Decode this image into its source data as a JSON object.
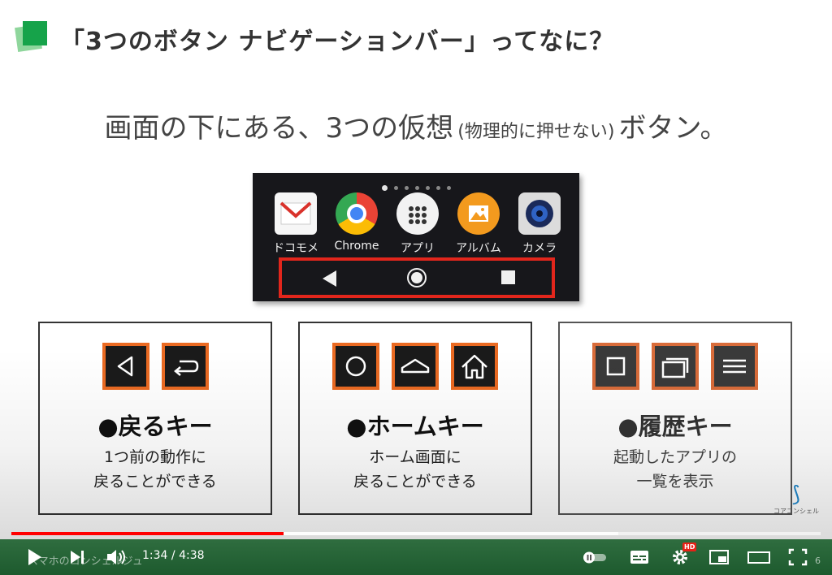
{
  "slide": {
    "title": "「3つのボタン ナビゲーションバー」ってなに？",
    "subtitle_main": "画面の下にある、3つの仮想",
    "subtitle_paren": "(物理的に押せない)",
    "subtitle_end": "ボタン。",
    "page_number": "6"
  },
  "phone": {
    "apps": [
      {
        "label": "ドコモメ",
        "icon": "mail-icon"
      },
      {
        "label": "Chrome",
        "icon": "chrome-icon"
      },
      {
        "label": "アプリ",
        "icon": "app-drawer-icon"
      },
      {
        "label": "アルバム",
        "icon": "album-icon"
      },
      {
        "label": "カメラ",
        "icon": "camera-icon"
      }
    ],
    "nav_buttons": [
      "back-triangle-icon",
      "home-circle-icon",
      "recent-square-icon"
    ]
  },
  "cards": [
    {
      "title": "●戻るキー",
      "desc_line1": "1つ前の動作に",
      "desc_line2": "戻ることができる",
      "icons": [
        "back-triangle-icon",
        "back-arrow-icon"
      ]
    },
    {
      "title": "●ホームキー",
      "desc_line1": "ホーム画面に",
      "desc_line2": "戻ることができる",
      "icons": [
        "home-circle-icon",
        "home-roof-icon",
        "home-house-icon"
      ]
    },
    {
      "title": "●履歴キー",
      "desc_line1": "起動したアプリの",
      "desc_line2": "一覧を表示",
      "icons": [
        "recent-square-icon",
        "recent-stack-icon",
        "recent-lines-icon"
      ]
    }
  ],
  "brand": {
    "corner_text": "コアコンシェル",
    "channel_watermark": "スマホのコンシェルジュ"
  },
  "player": {
    "time_current": "1:34",
    "time_separator": "/",
    "time_total": "4:38",
    "progress_played": 0.336,
    "progress_buffered": 0.75,
    "hd_label": "HD",
    "accent": "#ff0000"
  }
}
